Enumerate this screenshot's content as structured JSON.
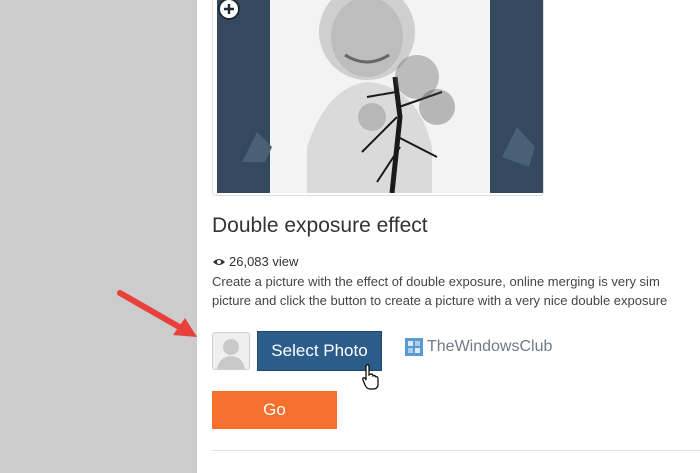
{
  "effect": {
    "title": "Double exposure effect",
    "views": "26,083 view",
    "description_line1": "Create a picture with the effect of double exposure, online merging is very sim",
    "description_line2": "picture and click the button to create a picture with a very nice double exposure"
  },
  "buttons": {
    "select_photo": "Select Photo",
    "go": "Go"
  },
  "watermark": {
    "text": "TheWindowsClub"
  },
  "icons": {
    "zoom": "zoom-in-icon",
    "eye": "eye-icon",
    "avatar": "user-placeholder-icon",
    "cursor": "hand-pointer-icon",
    "arrow": "red-arrow-annotation",
    "logo": "windows-club-logo-icon"
  },
  "colors": {
    "select_photo_bg": "#2c5d8a",
    "go_bg": "#f4702c",
    "annotation_arrow": "#e8413c",
    "left_gutter": "#cccccc"
  }
}
